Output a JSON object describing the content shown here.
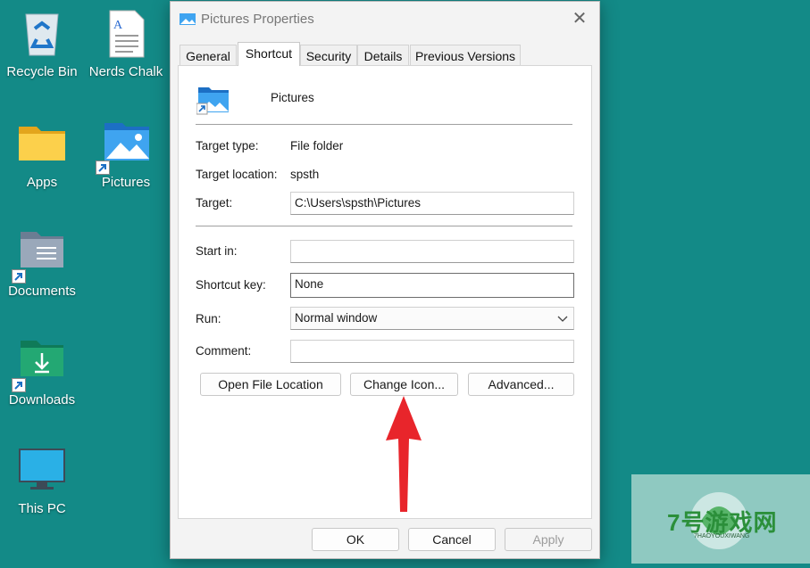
{
  "desktop": {
    "icons": [
      {
        "label": "Recycle Bin",
        "icon": "recycle-bin-icon"
      },
      {
        "label": "Nerds Chalk",
        "icon": "text-document-icon"
      },
      {
        "label": "Apps",
        "icon": "folder-icon"
      },
      {
        "label": "Pictures",
        "icon": "pictures-folder-icon"
      },
      {
        "label": "Documents",
        "icon": "documents-folder-icon"
      },
      {
        "label": "Downloads",
        "icon": "downloads-folder-icon"
      },
      {
        "label": "This PC",
        "icon": "monitor-icon"
      }
    ]
  },
  "dialog": {
    "title": "Pictures Properties",
    "close_glyph": "✕",
    "tabs": [
      "General",
      "Shortcut",
      "Security",
      "Details",
      "Previous Versions"
    ],
    "active_tab": "Shortcut",
    "item_name": "Pictures",
    "target_type_label": "Target type:",
    "target_type_value": "File folder",
    "target_location_label": "Target location:",
    "target_location_value": "spsth",
    "target_label": "Target:",
    "target_value": "C:\\Users\\spsth\\Pictures",
    "start_in_label": "Start in:",
    "start_in_value": "",
    "shortcut_key_label": "Shortcut key:",
    "shortcut_key_value": "None",
    "run_label": "Run:",
    "run_value": "Normal window",
    "comment_label": "Comment:",
    "comment_value": "",
    "buttons": {
      "open_file_location": "Open File Location",
      "change_icon": "Change Icon...",
      "advanced": "Advanced..."
    },
    "footer": {
      "ok": "OK",
      "cancel": "Cancel",
      "apply": "Apply"
    }
  },
  "colors": {
    "desktop_bg": "#138a87",
    "annotation_arrow": "#e8252b"
  },
  "watermark": {
    "brand": "7号游戏网",
    "sub": "7HAOYOUXIWANG"
  }
}
